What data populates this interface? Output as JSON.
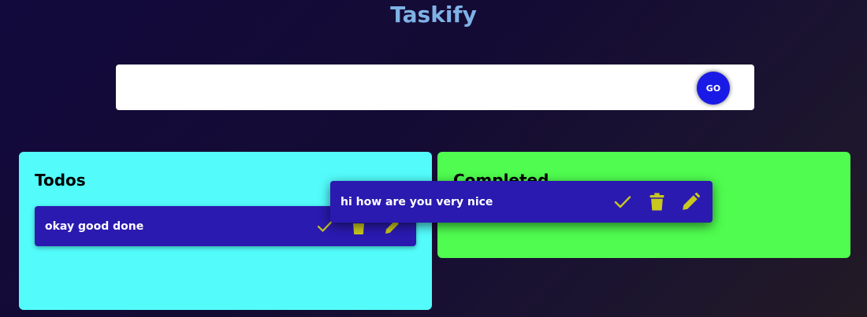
{
  "app": {
    "title": "Taskify"
  },
  "search": {
    "placeholder": "",
    "value": "",
    "go_label": "GO"
  },
  "panels": {
    "todos": {
      "heading": "Todos"
    },
    "completed": {
      "heading": "Completed"
    }
  },
  "tasks": {
    "todos": [
      {
        "text": "okay good done"
      }
    ],
    "dragging": {
      "text": "hi how are you very nice"
    }
  },
  "icons": {
    "done": "check-icon",
    "delete": "trash-icon",
    "edit": "pencil-icon"
  },
  "colors": {
    "title": "#7fb2e6",
    "go_button": "#1a1ae6",
    "todos_panel": "#53fbfb",
    "completed_panel": "#4ffc4f",
    "task_card": "#2a1ab0",
    "task_icon": "#c8c81e"
  }
}
